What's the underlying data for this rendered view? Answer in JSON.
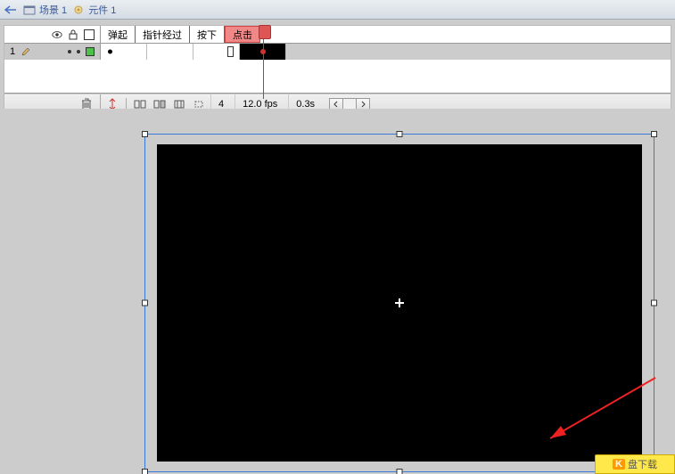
{
  "breadcrumb": {
    "scene": "场景 1",
    "symbol": "元件 1"
  },
  "frame_states": {
    "up": "弹起",
    "over": "指针经过",
    "down": "按下",
    "hit": "点击"
  },
  "layer": {
    "name": "1"
  },
  "timeline": {
    "current_frame": "4",
    "fps": "12.0 fps",
    "elapsed": "0.3s"
  },
  "watermark": {
    "text": "盘下载"
  }
}
